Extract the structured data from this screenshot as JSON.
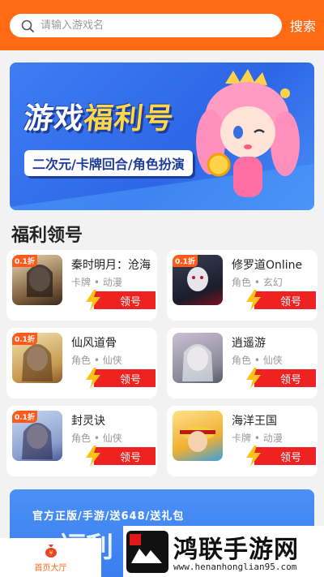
{
  "search": {
    "placeholder": "请输入游戏名",
    "button_label": "搜索"
  },
  "banner": {
    "title_part1": "游戏",
    "title_part2": "福利号",
    "subtitle": "二次元/卡牌回合/角色扮演"
  },
  "section": {
    "title": "福利领号"
  },
  "games": [
    {
      "name": "秦时明月：沧海",
      "meta": "卡牌 • 动漫",
      "button": "领号",
      "tag": "0.1折"
    },
    {
      "name": "修罗道Online",
      "meta": "角色 • 玄幻",
      "button": "领号",
      "tag": "0.1折"
    },
    {
      "name": "仙风道骨",
      "meta": "角色 • 仙侠",
      "button": "领号",
      "tag": "0.1折"
    },
    {
      "name": "逍遥游",
      "meta": "角色 • 仙侠",
      "button": "领号",
      "tag": ""
    },
    {
      "name": "封灵诀",
      "meta": "角色 • 仙侠",
      "button": "领号",
      "tag": "0.1折"
    },
    {
      "name": "海洋王国",
      "meta": "卡牌 • 动漫",
      "button": "领号",
      "tag": ""
    }
  ],
  "promo": {
    "text": "官方正版/手游/送648/送礼包",
    "big": "福利"
  },
  "bottom_nav": {
    "home_label": "首页大厅"
  },
  "watermark": {
    "text": "鸿联手游网",
    "url": "www.henanhonglian95.com"
  },
  "colors": {
    "brand": "#ff6a13",
    "claim": "#f02121",
    "banner_blue": "#3f7df2"
  }
}
